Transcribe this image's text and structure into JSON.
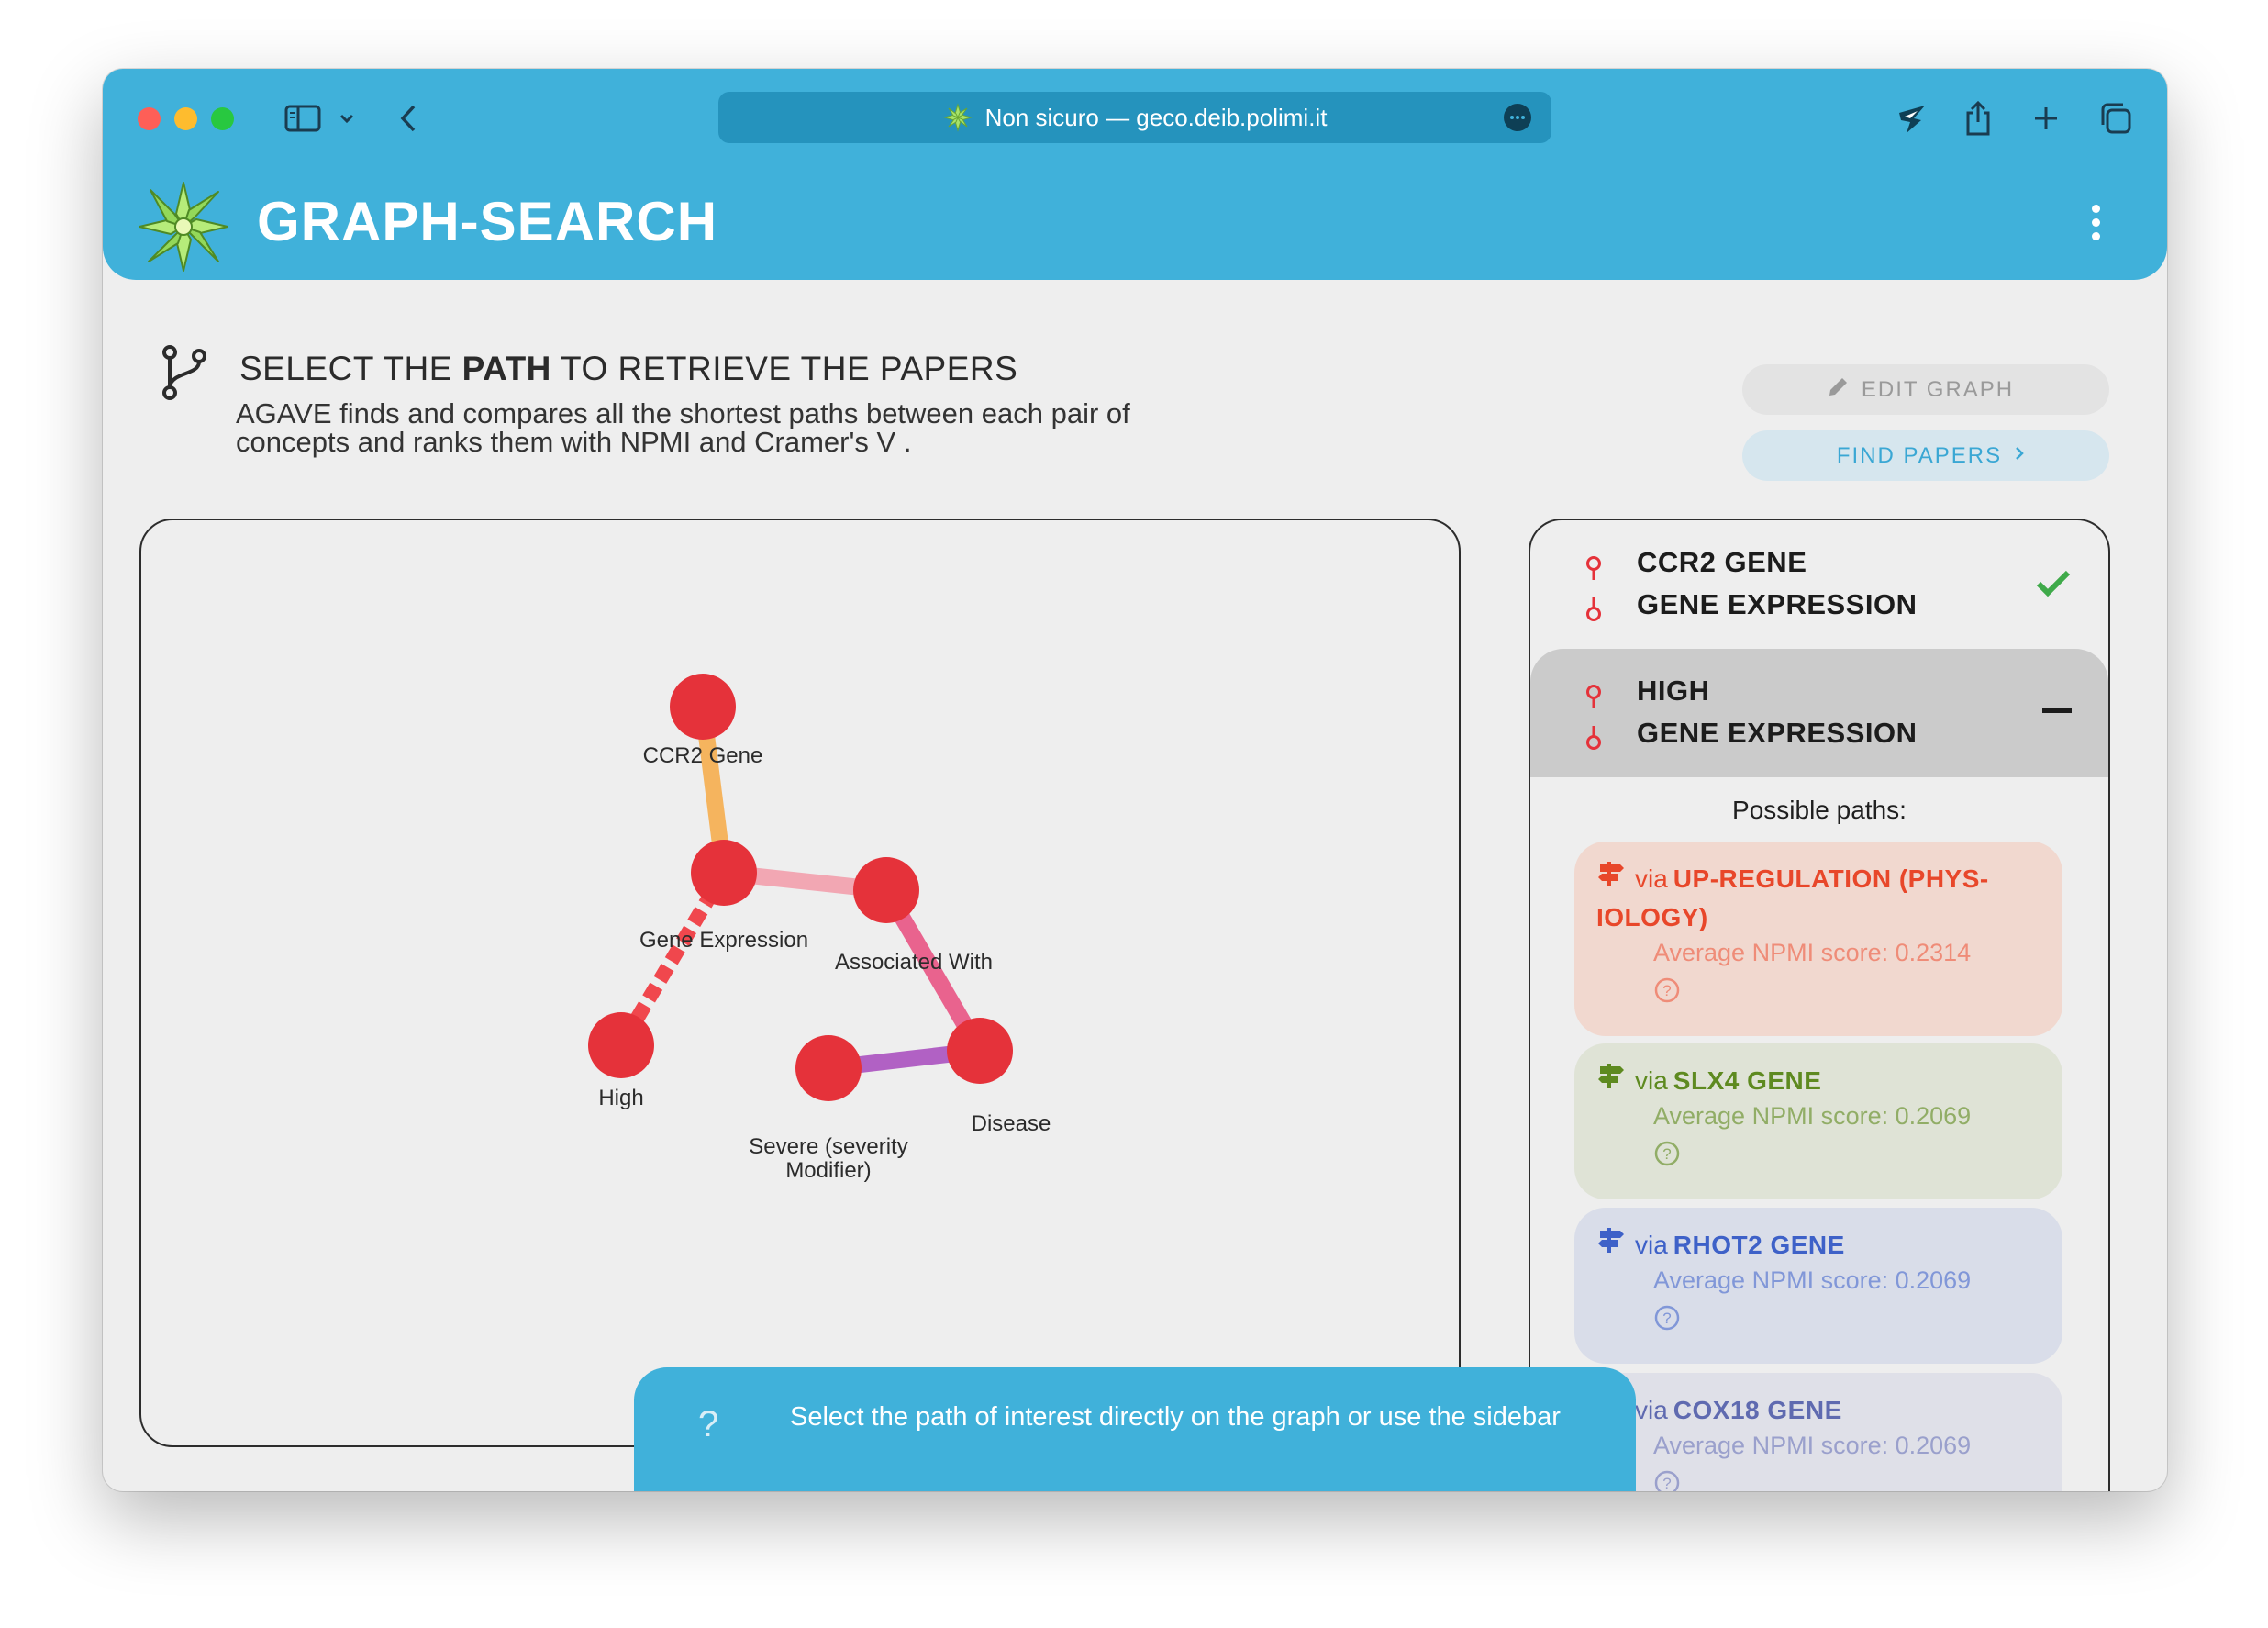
{
  "browser": {
    "url_text": "Non sicuro — geco.deib.polimi.it"
  },
  "app": {
    "title": "GRAPH-SEARCH"
  },
  "section": {
    "title_prefix": "SELECT THE ",
    "title_bold": "PATH",
    "title_suffix": " TO RETRIEVE THE PAPERS",
    "description": "AGAVE finds and compares all the shortest paths between each pair of concepts and ranks them with  NPMI  and  Cramer's V ."
  },
  "buttons": {
    "edit_graph": "EDIT GRAPH",
    "find_papers": "FIND PAPERS"
  },
  "graph": {
    "nodes": [
      {
        "id": "ccr2",
        "label": "CCR2 Gene"
      },
      {
        "id": "gene_expression",
        "label": "Gene Expression"
      },
      {
        "id": "associated_with",
        "label": "Associated With"
      },
      {
        "id": "high",
        "label": "High"
      },
      {
        "id": "disease",
        "label": "Disease"
      },
      {
        "id": "severe",
        "label": "Severe (severity Modifier)"
      }
    ],
    "node_color": "#e5323a",
    "edges": [
      {
        "from": "ccr2",
        "to": "gene_expression",
        "color": "#f5b45e",
        "style": "solid"
      },
      {
        "from": "gene_expression",
        "to": "associated_with",
        "color": "#f2a7b3",
        "style": "solid"
      },
      {
        "from": "gene_expression",
        "to": "high",
        "color": "#f0474d",
        "style": "dashed"
      },
      {
        "from": "associated_with",
        "to": "disease",
        "color": "#e9638e",
        "style": "solid"
      },
      {
        "from": "severe",
        "to": "disease",
        "color": "#b161c4",
        "style": "solid"
      }
    ]
  },
  "sidebar": {
    "pairs": [
      {
        "from": "CCR2 GENE",
        "to": "GENE EXPRESSION",
        "state": "check-icon"
      },
      {
        "from": "HIGH",
        "to": "GENE EXPRESSION",
        "state": "collapse-icon"
      }
    ],
    "possible_paths_label": "Possible paths:",
    "paths": [
      {
        "via": "via",
        "name": "UP-REGULATION (PHYS-IOLOGY)",
        "score": "Average NPMI score: 0.2314"
      },
      {
        "via": "via",
        "name": "SLX4 GENE",
        "score": "Average NPMI score: 0.2069"
      },
      {
        "via": "via",
        "name": "RHOT2 GENE",
        "score": "Average NPMI score: 0.2069"
      },
      {
        "via": "via",
        "name": "COX18 GENE",
        "score": "Average NPMI score: 0.2069"
      }
    ]
  },
  "toast": {
    "icon": "?",
    "message": "Select the path of interest directly on the graph or use the sidebar"
  }
}
